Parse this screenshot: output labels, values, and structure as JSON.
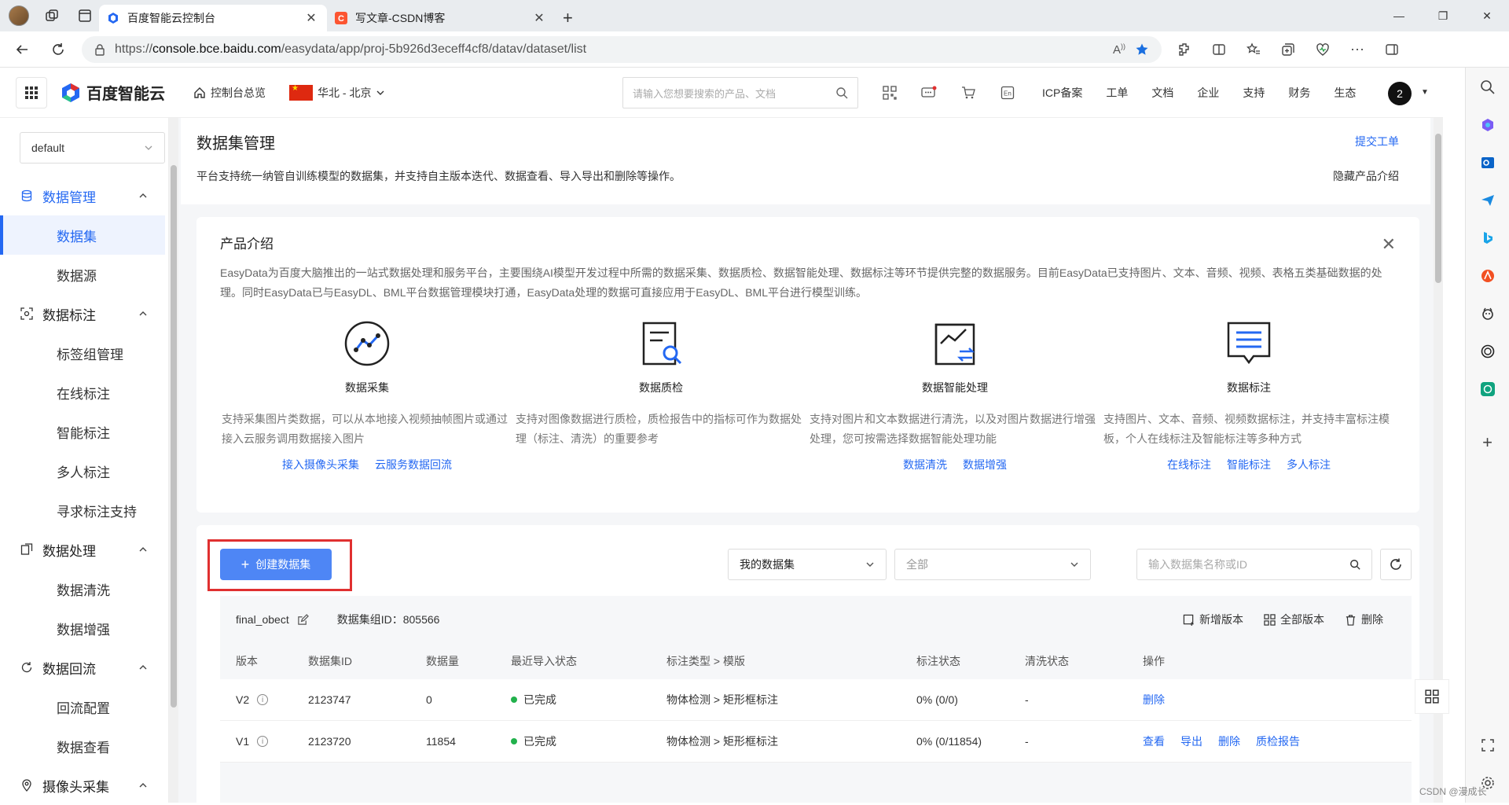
{
  "browser": {
    "tabs": [
      {
        "title": "百度智能云控制台",
        "active": true
      },
      {
        "title": "写文章-CSDN博客",
        "active": false
      }
    ],
    "new_tab": "+",
    "url_prefix": "https://",
    "url_host": "console.bce.baidu.com",
    "url_path": "/easydata/app/proj-5b926d3eceff4cf8/datav/dataset/list"
  },
  "topnav": {
    "brand": "百度智能云",
    "console_home": "控制台总览",
    "region": "华北 - 北京",
    "search_placeholder": "请输入您想要搜索的产品、文档",
    "links": [
      "ICP备案",
      "工单",
      "文档",
      "企业",
      "支持",
      "财务",
      "生态"
    ],
    "user_badge": "2"
  },
  "sidebar": {
    "project": "default",
    "groups": [
      {
        "label": "数据管理",
        "icon": "database-icon",
        "active": true,
        "items": [
          {
            "label": "数据集",
            "active": true
          },
          {
            "label": "数据源",
            "active": false
          }
        ]
      },
      {
        "label": "数据标注",
        "icon": "annotate-icon",
        "active": false,
        "items": [
          {
            "label": "标签组管理"
          },
          {
            "label": "在线标注"
          },
          {
            "label": "智能标注"
          },
          {
            "label": "多人标注"
          },
          {
            "label": "寻求标注支持"
          }
        ]
      },
      {
        "label": "数据处理",
        "icon": "process-icon",
        "active": false,
        "items": [
          {
            "label": "数据清洗"
          },
          {
            "label": "数据增强"
          }
        ]
      },
      {
        "label": "数据回流",
        "icon": "reflow-icon",
        "active": false,
        "items": [
          {
            "label": "回流配置"
          },
          {
            "label": "数据查看"
          }
        ]
      },
      {
        "label": "摄像头采集",
        "icon": "location-icon",
        "active": false,
        "items": []
      }
    ]
  },
  "page": {
    "title": "数据集管理",
    "desc": "平台支持统一纳管自训练模型的数据集，并支持自主版本迭代、数据查看、导入导出和删除等操作。",
    "submit_ticket": "提交工单",
    "hide_intro": "隐藏产品介绍"
  },
  "intro": {
    "title": "产品介绍",
    "desc": "EasyData为百度大脑推出的一站式数据处理和服务平台，主要围绕AI模型开发过程中所需的数据采集、数据质检、数据智能处理、数据标注等环节提供完整的数据服务。目前EasyData已支持图片、文本、音频、视频、表格五类基础数据的处理。同时EasyData已与EasyDL、BML平台数据管理模块打通，EasyData处理的数据可直接应用于EasyDL、BML平台进行模型训练。",
    "cards": [
      {
        "name": "数据采集",
        "icon": "data-collect-icon",
        "desc": "支持采集图片类数据，可以从本地接入视频抽帧图片或通过接入云服务调用数据接入图片",
        "links": [
          "接入摄像头采集",
          "云服务数据回流"
        ]
      },
      {
        "name": "数据质检",
        "icon": "data-quality-icon",
        "desc": "支持对图像数据进行质检，质检报告中的指标可作为数据处理（标注、清洗）的重要参考",
        "links": []
      },
      {
        "name": "数据智能处理",
        "icon": "data-smart-process-icon",
        "desc": "支持对图片和文本数据进行清洗，以及对图片数据进行增强处理，您可按需选择数据智能处理功能",
        "links": [
          "数据清洗",
          "数据增强"
        ]
      },
      {
        "name": "数据标注",
        "icon": "data-label-icon",
        "desc": "支持图片、文本、音频、视频数据标注，并支持丰富标注模板，个人在线标注及智能标注等多种方式",
        "links": [
          "在线标注",
          "智能标注",
          "多人标注"
        ]
      }
    ]
  },
  "list": {
    "create_label": "创建数据集",
    "filter_mine": "我的数据集",
    "filter_all": "全部",
    "search_placeholder": "输入数据集名称或ID",
    "group": {
      "name": "final_obect",
      "id_label": "数据集组ID：805566",
      "actions": [
        "新增版本",
        "全部版本",
        "删除"
      ]
    },
    "columns": [
      "版本",
      "数据集ID",
      "数据量",
      "最近导入状态",
      "标注类型 > 模版",
      "标注状态",
      "清洗状态",
      "操作"
    ],
    "rows": [
      {
        "version": "V2",
        "id": "2123747",
        "count": "0",
        "import_status": "已完成",
        "type": "物体检测 > 矩形框标注",
        "label_status": "0% (0/0)",
        "clean_status": "-",
        "ops": [
          "删除"
        ]
      },
      {
        "version": "V1",
        "id": "2123720",
        "count": "11854",
        "import_status": "已完成",
        "type": "物体检测 > 矩形框标注",
        "label_status": "0% (0/11854)",
        "clean_status": "-",
        "ops": [
          "查看",
          "导出",
          "删除",
          "质检报告"
        ]
      }
    ]
  },
  "watermark": "CSDN @漫成长",
  "colors": {
    "primary": "#2468f2",
    "button": "#4e86f5",
    "highlight": "#e03030",
    "success": "#22b14c"
  }
}
